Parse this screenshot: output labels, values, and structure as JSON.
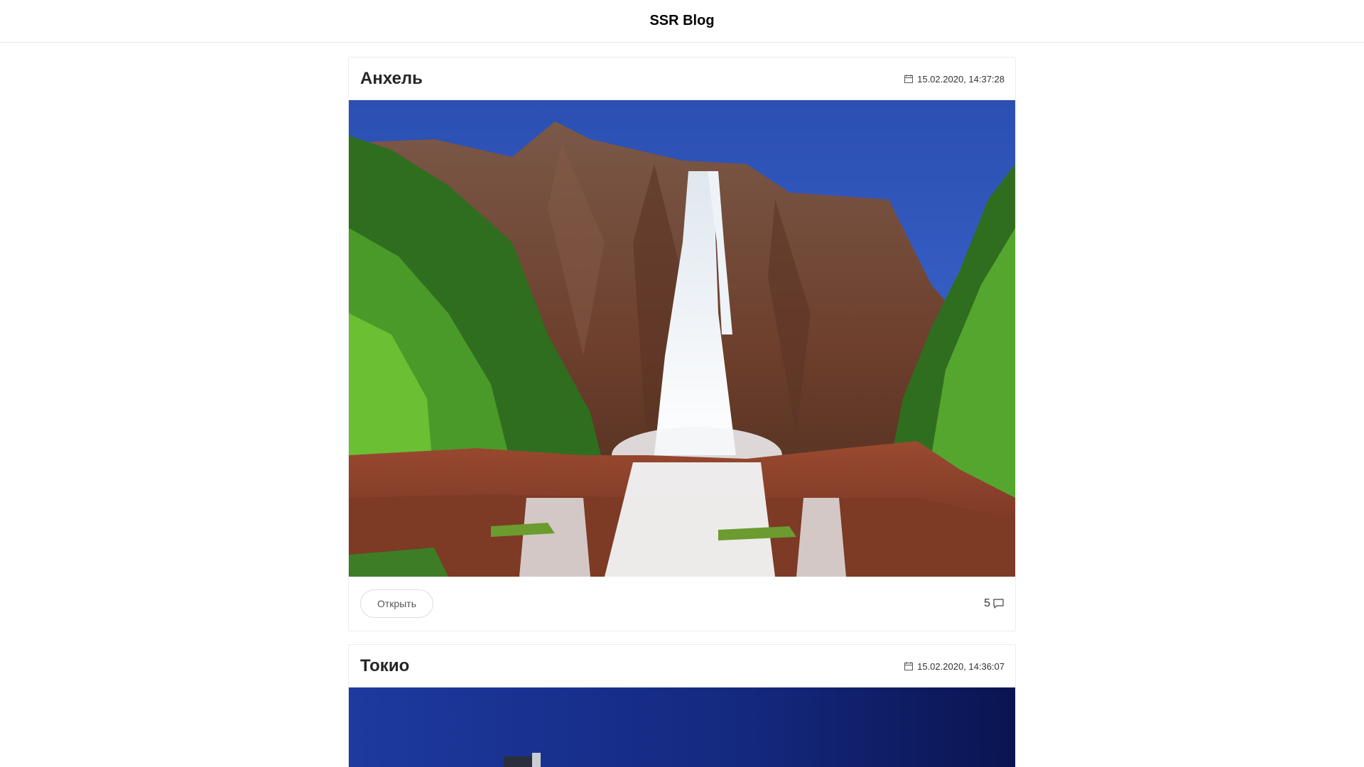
{
  "header": {
    "title": "SSR Blog"
  },
  "posts": [
    {
      "title": "Анхель",
      "date": "15.02.2020, 14:37:28",
      "image": "waterfall-photo",
      "open_label": "Открыть",
      "comments_count": "5"
    },
    {
      "title": "Токио",
      "date": "15.02.2020, 14:36:07",
      "image": "tokyo-night-photo"
    }
  ],
  "icons": {
    "date": "calendar-icon",
    "comments": "comment-icon"
  }
}
